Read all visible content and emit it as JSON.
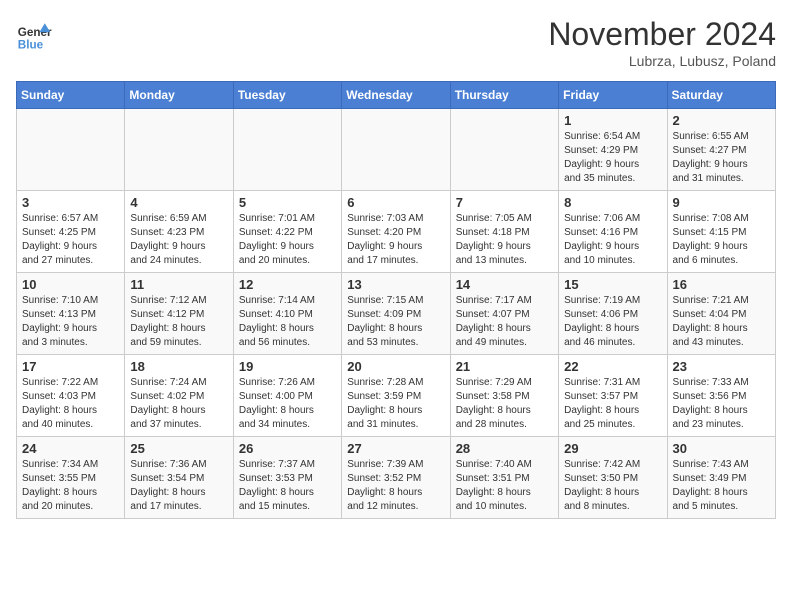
{
  "header": {
    "logo_line1": "General",
    "logo_line2": "Blue",
    "month": "November 2024",
    "location": "Lubrza, Lubusz, Poland"
  },
  "days_of_week": [
    "Sunday",
    "Monday",
    "Tuesday",
    "Wednesday",
    "Thursday",
    "Friday",
    "Saturday"
  ],
  "weeks": [
    [
      {
        "num": "",
        "info": ""
      },
      {
        "num": "",
        "info": ""
      },
      {
        "num": "",
        "info": ""
      },
      {
        "num": "",
        "info": ""
      },
      {
        "num": "",
        "info": ""
      },
      {
        "num": "1",
        "info": "Sunrise: 6:54 AM\nSunset: 4:29 PM\nDaylight: 9 hours\nand 35 minutes."
      },
      {
        "num": "2",
        "info": "Sunrise: 6:55 AM\nSunset: 4:27 PM\nDaylight: 9 hours\nand 31 minutes."
      }
    ],
    [
      {
        "num": "3",
        "info": "Sunrise: 6:57 AM\nSunset: 4:25 PM\nDaylight: 9 hours\nand 27 minutes."
      },
      {
        "num": "4",
        "info": "Sunrise: 6:59 AM\nSunset: 4:23 PM\nDaylight: 9 hours\nand 24 minutes."
      },
      {
        "num": "5",
        "info": "Sunrise: 7:01 AM\nSunset: 4:22 PM\nDaylight: 9 hours\nand 20 minutes."
      },
      {
        "num": "6",
        "info": "Sunrise: 7:03 AM\nSunset: 4:20 PM\nDaylight: 9 hours\nand 17 minutes."
      },
      {
        "num": "7",
        "info": "Sunrise: 7:05 AM\nSunset: 4:18 PM\nDaylight: 9 hours\nand 13 minutes."
      },
      {
        "num": "8",
        "info": "Sunrise: 7:06 AM\nSunset: 4:16 PM\nDaylight: 9 hours\nand 10 minutes."
      },
      {
        "num": "9",
        "info": "Sunrise: 7:08 AM\nSunset: 4:15 PM\nDaylight: 9 hours\nand 6 minutes."
      }
    ],
    [
      {
        "num": "10",
        "info": "Sunrise: 7:10 AM\nSunset: 4:13 PM\nDaylight: 9 hours\nand 3 minutes."
      },
      {
        "num": "11",
        "info": "Sunrise: 7:12 AM\nSunset: 4:12 PM\nDaylight: 8 hours\nand 59 minutes."
      },
      {
        "num": "12",
        "info": "Sunrise: 7:14 AM\nSunset: 4:10 PM\nDaylight: 8 hours\nand 56 minutes."
      },
      {
        "num": "13",
        "info": "Sunrise: 7:15 AM\nSunset: 4:09 PM\nDaylight: 8 hours\nand 53 minutes."
      },
      {
        "num": "14",
        "info": "Sunrise: 7:17 AM\nSunset: 4:07 PM\nDaylight: 8 hours\nand 49 minutes."
      },
      {
        "num": "15",
        "info": "Sunrise: 7:19 AM\nSunset: 4:06 PM\nDaylight: 8 hours\nand 46 minutes."
      },
      {
        "num": "16",
        "info": "Sunrise: 7:21 AM\nSunset: 4:04 PM\nDaylight: 8 hours\nand 43 minutes."
      }
    ],
    [
      {
        "num": "17",
        "info": "Sunrise: 7:22 AM\nSunset: 4:03 PM\nDaylight: 8 hours\nand 40 minutes."
      },
      {
        "num": "18",
        "info": "Sunrise: 7:24 AM\nSunset: 4:02 PM\nDaylight: 8 hours\nand 37 minutes."
      },
      {
        "num": "19",
        "info": "Sunrise: 7:26 AM\nSunset: 4:00 PM\nDaylight: 8 hours\nand 34 minutes."
      },
      {
        "num": "20",
        "info": "Sunrise: 7:28 AM\nSunset: 3:59 PM\nDaylight: 8 hours\nand 31 minutes."
      },
      {
        "num": "21",
        "info": "Sunrise: 7:29 AM\nSunset: 3:58 PM\nDaylight: 8 hours\nand 28 minutes."
      },
      {
        "num": "22",
        "info": "Sunrise: 7:31 AM\nSunset: 3:57 PM\nDaylight: 8 hours\nand 25 minutes."
      },
      {
        "num": "23",
        "info": "Sunrise: 7:33 AM\nSunset: 3:56 PM\nDaylight: 8 hours\nand 23 minutes."
      }
    ],
    [
      {
        "num": "24",
        "info": "Sunrise: 7:34 AM\nSunset: 3:55 PM\nDaylight: 8 hours\nand 20 minutes."
      },
      {
        "num": "25",
        "info": "Sunrise: 7:36 AM\nSunset: 3:54 PM\nDaylight: 8 hours\nand 17 minutes."
      },
      {
        "num": "26",
        "info": "Sunrise: 7:37 AM\nSunset: 3:53 PM\nDaylight: 8 hours\nand 15 minutes."
      },
      {
        "num": "27",
        "info": "Sunrise: 7:39 AM\nSunset: 3:52 PM\nDaylight: 8 hours\nand 12 minutes."
      },
      {
        "num": "28",
        "info": "Sunrise: 7:40 AM\nSunset: 3:51 PM\nDaylight: 8 hours\nand 10 minutes."
      },
      {
        "num": "29",
        "info": "Sunrise: 7:42 AM\nSunset: 3:50 PM\nDaylight: 8 hours\nand 8 minutes."
      },
      {
        "num": "30",
        "info": "Sunrise: 7:43 AM\nSunset: 3:49 PM\nDaylight: 8 hours\nand 5 minutes."
      }
    ]
  ]
}
